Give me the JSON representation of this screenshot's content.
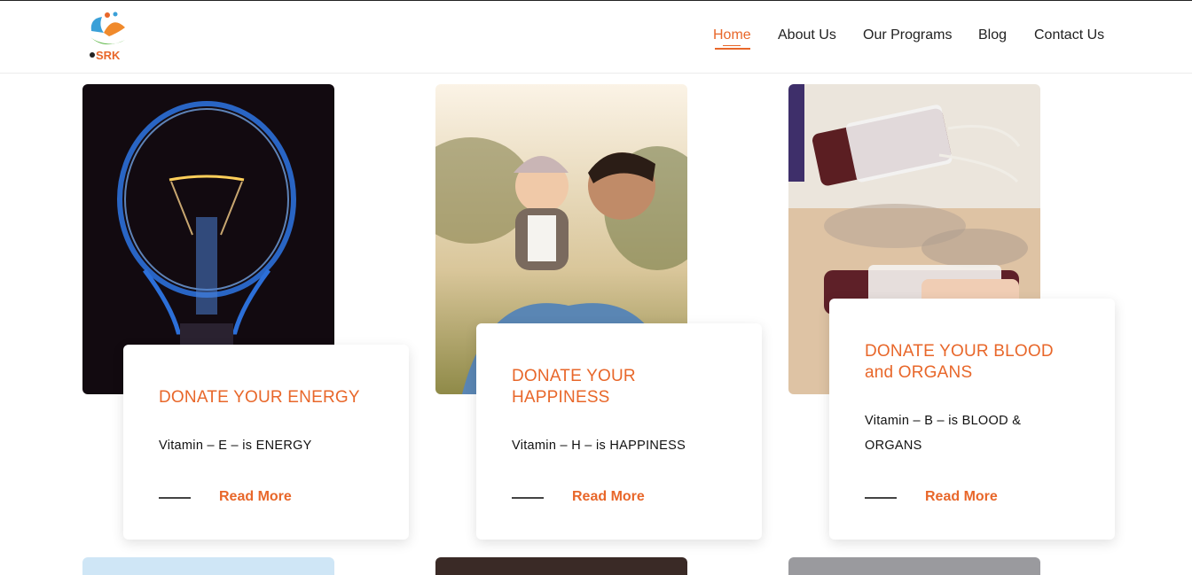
{
  "brand": {
    "logo_text": "SRK"
  },
  "nav": {
    "items": [
      {
        "label": "Home",
        "active": true
      },
      {
        "label": "About Us",
        "active": false
      },
      {
        "label": "Our Programs",
        "active": false
      },
      {
        "label": "Blog",
        "active": false
      },
      {
        "label": "Contact Us",
        "active": false
      }
    ]
  },
  "cards": [
    {
      "title": "DONATE YOUR ENERGY",
      "text": "Vitamin – E – is ENERGY",
      "link": "Read More",
      "image": "light-bulb"
    },
    {
      "title": "DONATE YOUR HAPPINESS",
      "text": "Vitamin – H – is HAPPINESS",
      "link": "Read More",
      "image": "father-and-baby"
    },
    {
      "title": "DONATE YOUR BLOOD and ORGANS",
      "text": "Vitamin – B – is BLOOD & ORGANS",
      "link": "Read More",
      "image": "blood-bags"
    }
  ],
  "colors": {
    "accent": "#e8672a",
    "text": "#222222"
  }
}
